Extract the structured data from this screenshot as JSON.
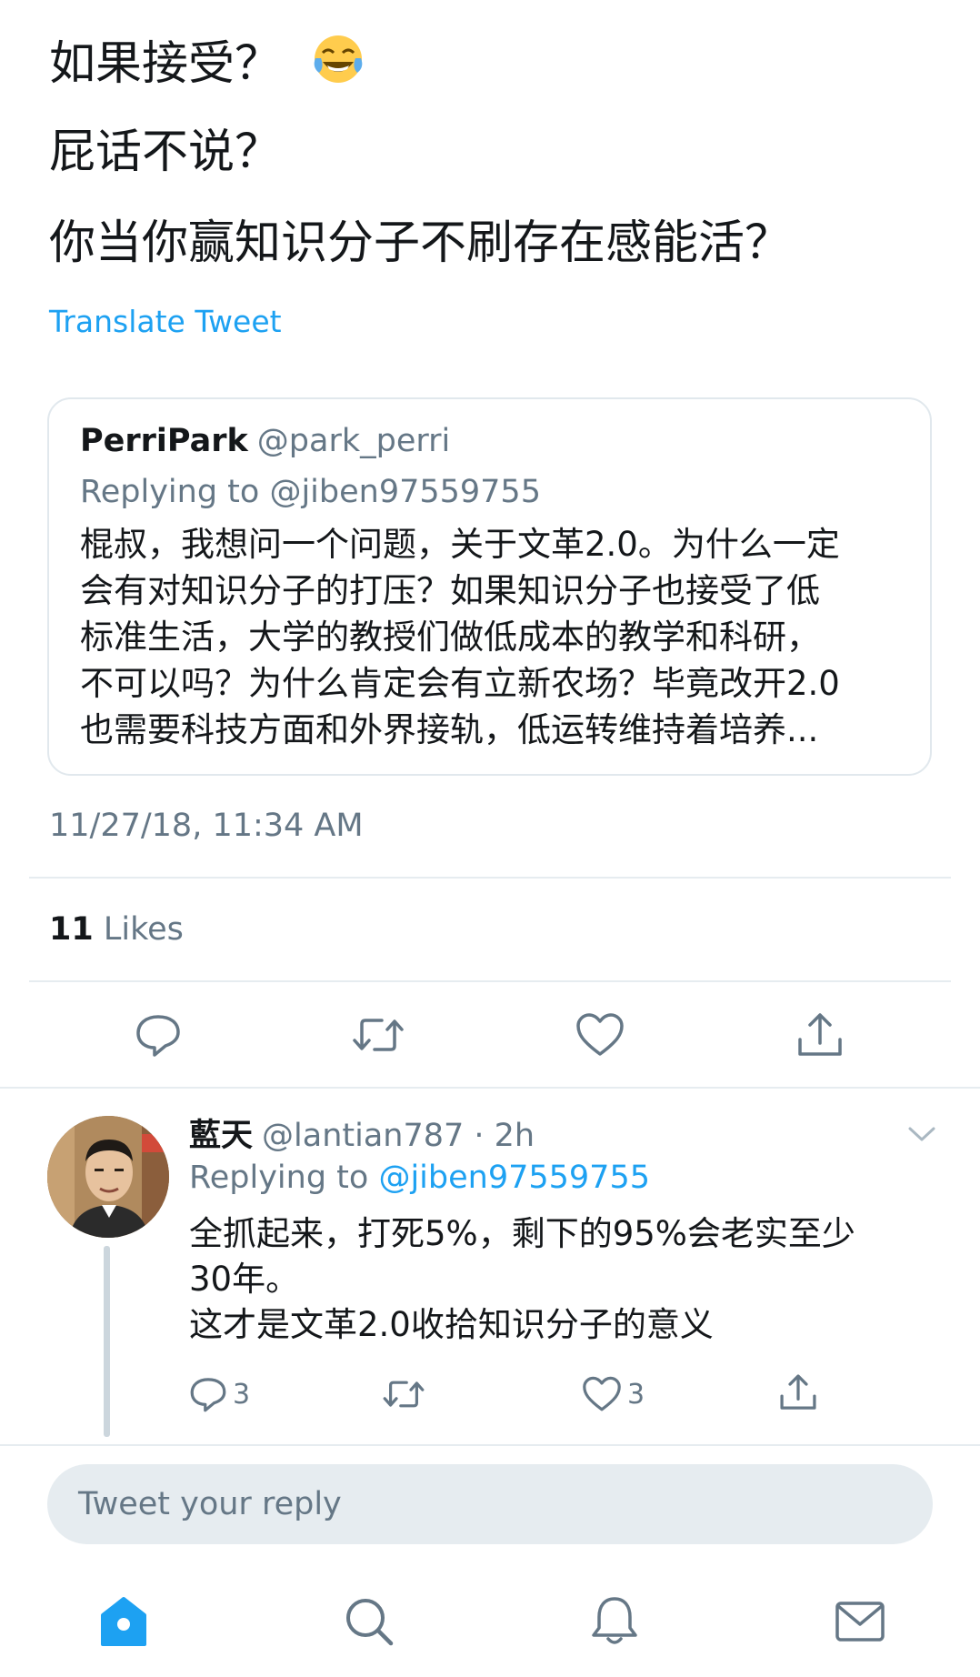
{
  "tweet": {
    "lines": [
      "如果接受？",
      "屁话不说？",
      "你当你赢知识分子不刷存在感能活？"
    ],
    "emoji": "laughing-with-tears",
    "translate_label": "Translate Tweet",
    "timestamp": "11/27/18, 11:34 AM",
    "likes_count": "11",
    "likes_label": "Likes"
  },
  "quoted": {
    "name": "PerriPark",
    "handle": "@park_perri",
    "replying_to": "Replying to @jiben97559755",
    "body_lines": [
      "棍叔，我想问一个问题，关于文革2.0。为什么一定",
      "会有对知识分子的打压？如果知识分子也接受了低",
      "标准生活，大学的教授们做低成本的教学和科研，",
      "不可以吗？为什么肯定会有立新农场？毕竟改开2.0",
      "也需要科技方面和外界接轨，低运转维持着培养..."
    ]
  },
  "reply": {
    "name": "藍天",
    "handle_time": "@lantian787 · 2h",
    "replying_prefix": "Replying to ",
    "replying_handle": "@jiben97559755",
    "body_lines": [
      "全抓起来，打死5%，剩下的95%会老实至少",
      "30年。",
      "这才是文革2.0收拾知识分子的意义"
    ],
    "reply_count": "3",
    "like_count": "3"
  },
  "composer": {
    "placeholder": "Tweet your reply"
  },
  "colors": {
    "accent": "#1da1f2",
    "secondary_text": "#657786",
    "icon_gray": "#657786",
    "divider": "#e6ecf0"
  },
  "icons": {
    "actions": [
      "reply-icon",
      "retweet-icon",
      "like-icon",
      "share-icon"
    ],
    "tabbar": [
      "home-icon",
      "search-icon",
      "notifications-icon",
      "messages-icon"
    ]
  }
}
